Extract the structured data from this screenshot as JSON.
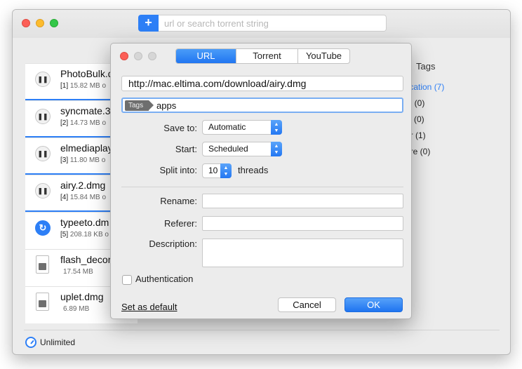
{
  "toolbar": {
    "add_label": "+",
    "search_placeholder": "url or search torrent string"
  },
  "downloads": [
    {
      "name": "PhotoBulk.d",
      "index": "[1]",
      "size": "15.82 MB o",
      "state": "paused",
      "icon": "pause-icon",
      "progress": 1.0
    },
    {
      "name": "syncmate.3",
      "index": "[2]",
      "size": "14.73 MB o",
      "state": "paused",
      "icon": "pause-icon",
      "progress": 1.0
    },
    {
      "name": "elmediaplay",
      "index": "[3]",
      "size": "11.80 MB o",
      "state": "paused",
      "icon": "pause-icon",
      "progress": 1.0
    },
    {
      "name": "airy.2.dmg",
      "index": "[4]",
      "size": "15.84 MB o",
      "state": "paused",
      "icon": "pause-icon",
      "progress": 1.0
    },
    {
      "name": "typeeto.dm",
      "index": "[5]",
      "size": "208.18 KB o",
      "state": "scheduled",
      "icon": "refresh-icon",
      "progress": 0
    },
    {
      "name": "flash_decor",
      "index": "",
      "size": "17.54 MB",
      "state": "file",
      "icon": "dmg-file-icon",
      "progress": 0
    },
    {
      "name": "uplet.dmg",
      "index": "",
      "size": "6.89 MB",
      "state": "file",
      "icon": "dmg-file-icon",
      "progress": 0
    }
  ],
  "tags_panel": {
    "header": "Tags",
    "items": [
      {
        "label": "lication (7)",
        "active": true
      },
      {
        "label": "ie (0)",
        "active": false
      },
      {
        "label": "ic (0)",
        "active": false
      },
      {
        "label": "er (1)",
        "active": false
      },
      {
        "label": "ure (0)",
        "active": false
      }
    ]
  },
  "status": {
    "speed_label": "Unlimited"
  },
  "dialog": {
    "tabs": [
      {
        "label": "URL",
        "selected": true
      },
      {
        "label": "Torrent",
        "selected": false
      },
      {
        "label": "YouTube",
        "selected": false
      }
    ],
    "url_value": "http://mac.eltima.com/download/airy.dmg",
    "tags_chip": "Tags",
    "tags_value": "apps",
    "save_to_label": "Save to:",
    "save_to_value": "Automatic",
    "start_label": "Start:",
    "start_value": "Scheduled",
    "split_label": "Split into:",
    "split_value": "10",
    "threads_label": "threads",
    "rename_label": "Rename:",
    "referer_label": "Referer:",
    "description_label": "Description:",
    "auth_label": "Authentication",
    "set_default_label": "Set as default",
    "cancel_label": "Cancel",
    "ok_label": "OK"
  },
  "colors": {
    "accent": "#2d7ff6",
    "close_red": "#fc5f57",
    "minimize_yellow": "#fdbc2e",
    "zoom_green": "#33c748"
  }
}
